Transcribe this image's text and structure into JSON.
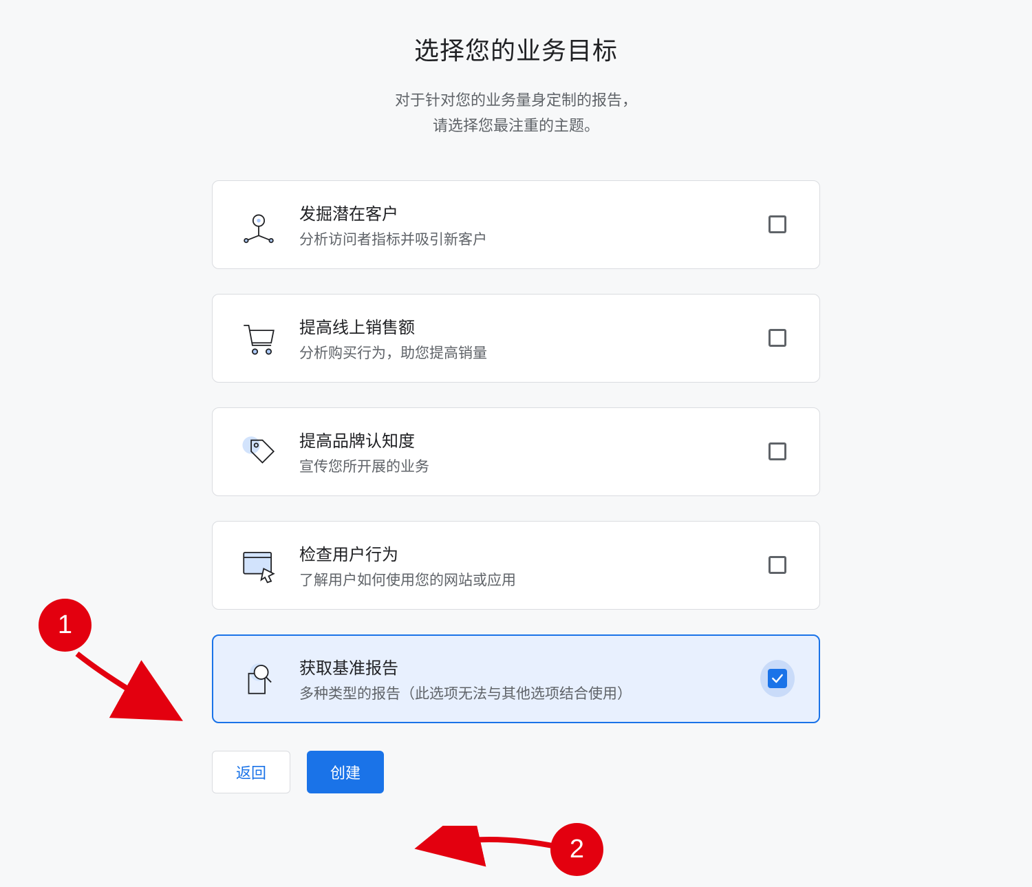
{
  "header": {
    "title": "选择您的业务目标",
    "subtitle_line1": "对于针对您的业务量身定制的报告，",
    "subtitle_line2": "请选择您最注重的主题。"
  },
  "options": [
    {
      "id": "leads",
      "title": "发掘潜在客户",
      "desc": "分析访问者指标并吸引新客户",
      "checked": false
    },
    {
      "id": "sales",
      "title": "提高线上销售额",
      "desc": "分析购买行为，助您提高销量",
      "checked": false
    },
    {
      "id": "brand",
      "title": "提高品牌认知度",
      "desc": "宣传您所开展的业务",
      "checked": false
    },
    {
      "id": "behavior",
      "title": "检查用户行为",
      "desc": "了解用户如何使用您的网站或应用",
      "checked": false
    },
    {
      "id": "baseline",
      "title": "获取基准报告",
      "desc": "多种类型的报告（此选项无法与其他选项结合使用）",
      "checked": true
    }
  ],
  "buttons": {
    "back": "返回",
    "create": "创建"
  },
  "annotations": {
    "badge1": "1",
    "badge2": "2"
  }
}
